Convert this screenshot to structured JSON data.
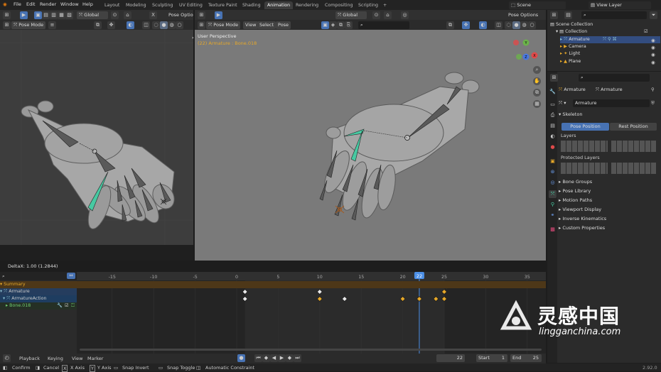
{
  "menu": [
    "File",
    "Edit",
    "Render",
    "Window",
    "Help"
  ],
  "workspaces": [
    "Layout",
    "Modeling",
    "Sculpting",
    "UV Editing",
    "Texture Paint",
    "Shading",
    "Animation",
    "Rendering",
    "Compositing",
    "Scripting"
  ],
  "active_workspace": "Animation",
  "scene": "Scene",
  "view_layer": "View Layer",
  "left_header": {
    "orientation": "Global",
    "pose_options": "Pose Option",
    "mode": "Pose Mode"
  },
  "main_header": {
    "orientation": "Global",
    "pose_options": "Pose Options",
    "mode": "Pose Mode",
    "view": "View",
    "select": "Select",
    "pose": "Pose"
  },
  "viewport_overlay": {
    "perspective": "User Perspective",
    "context": "(22) Armature : Bone.018"
  },
  "gizmo": {
    "x": "X",
    "y": "Y",
    "z": "Z"
  },
  "status_delta": "DeltaX: 1.00 (1.2844)",
  "outliner": {
    "scene_collection": "Scene Collection",
    "collection": "Collection",
    "items": [
      "Armature",
      "Camera",
      "Light",
      "Plane"
    ]
  },
  "properties": {
    "breadcrumb_a": "Armature",
    "breadcrumb_b": "Armature",
    "data_name": "Armature",
    "skeleton": "Skeleton",
    "pose_position": "Pose Position",
    "rest_position": "Rest Position",
    "layers": "Layers",
    "protected_layers": "Protected Layers",
    "panels": [
      "Bone Groups",
      "Pose Library",
      "Motion Paths",
      "Viewport Display",
      "Inverse Kinematics",
      "Custom Properties"
    ]
  },
  "timeline": {
    "ticks": [
      "-15",
      "-10",
      "-5",
      "0",
      "5",
      "10",
      "15",
      "20",
      "22",
      "25",
      "30",
      "35"
    ],
    "current_frame": "22",
    "channels": [
      "Summary",
      "Armature",
      "ArmatureAction",
      "Bone.018"
    ],
    "menu": [
      "Playback",
      "Keying",
      "View",
      "Marker"
    ],
    "frame_field": "22",
    "start_label": "Start",
    "start": "1",
    "end_label": "End",
    "end": "25"
  },
  "statusbar": [
    "Confirm",
    "Cancel",
    "X Axis",
    "Y Axis",
    "Snap Invert",
    "Snap Toggle",
    "Automatic Constraint"
  ],
  "status_keys": [
    "X",
    "Y"
  ],
  "version": "2.92.0",
  "watermark": {
    "brand": "灵感中国",
    "url": "lingganchina.com"
  },
  "colors": {
    "accent": "#4772b3",
    "keyframe_selected": "#e6a82a",
    "keyframe": "#e8e8e8",
    "playhead": "#4c8fe6",
    "bone_selected": "#47c9a2"
  }
}
